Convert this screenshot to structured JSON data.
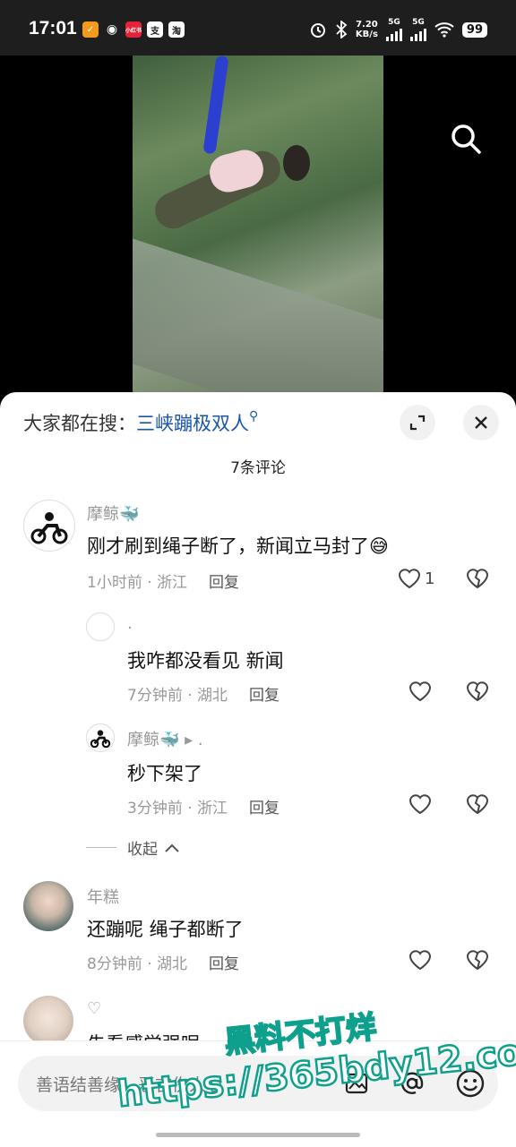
{
  "status_bar": {
    "time": "17:01",
    "apps": [
      {
        "name": "app-orange-icon",
        "label": "✓",
        "color": "#f39a1e"
      },
      {
        "name": "wechat-icon",
        "label": "◉",
        "color": "#444444"
      },
      {
        "name": "xiaohongshu-icon",
        "label": "小红书",
        "color": "#e52238"
      },
      {
        "name": "alipay-icon",
        "label": "支",
        "color": "#ffffff"
      },
      {
        "name": "taobao-icon",
        "label": "淘",
        "color": "#ffffff"
      }
    ],
    "speed_value": "7.20",
    "speed_unit": "KB/s",
    "net1": "5G",
    "net2": "5G",
    "battery": "99"
  },
  "sheet": {
    "hot_search_prefix": "大家都在搜：",
    "hot_search_keyword": "三峡蹦极双人",
    "comment_count": "7条评论"
  },
  "comments": [
    {
      "user": "摩鲸🐳",
      "text": "刚才刷到绳子断了，新闻立马封了😅",
      "time": "1小时前",
      "region": "浙江",
      "reply_label": "回复",
      "likes": "1"
    },
    {
      "user": ".",
      "text": "我咋都没看见  新闻",
      "time": "7分钟前",
      "region": "湖北",
      "reply_label": "回复",
      "likes": ""
    },
    {
      "user": "摩鲸🐳",
      "reply_to": "▸ .",
      "text": "秒下架了",
      "time": "3分钟前",
      "region": "浙江",
      "reply_label": "回复",
      "likes": ""
    },
    {
      "user": "年糕",
      "text": "还蹦呢 绳子都断了",
      "time": "8分钟前",
      "region": "湖北",
      "reply_label": "回复",
      "likes": ""
    },
    {
      "user": "♡",
      "text": "先看感觉强呢",
      "time": "",
      "region": "",
      "reply_label": "",
      "likes": ""
    }
  ],
  "collapse_label": "收起",
  "input": {
    "placeholder": "善语结善缘，恶言伤人心"
  },
  "watermark": {
    "line1": "黑料不打烊",
    "line2": "https://365bdy12.com"
  }
}
